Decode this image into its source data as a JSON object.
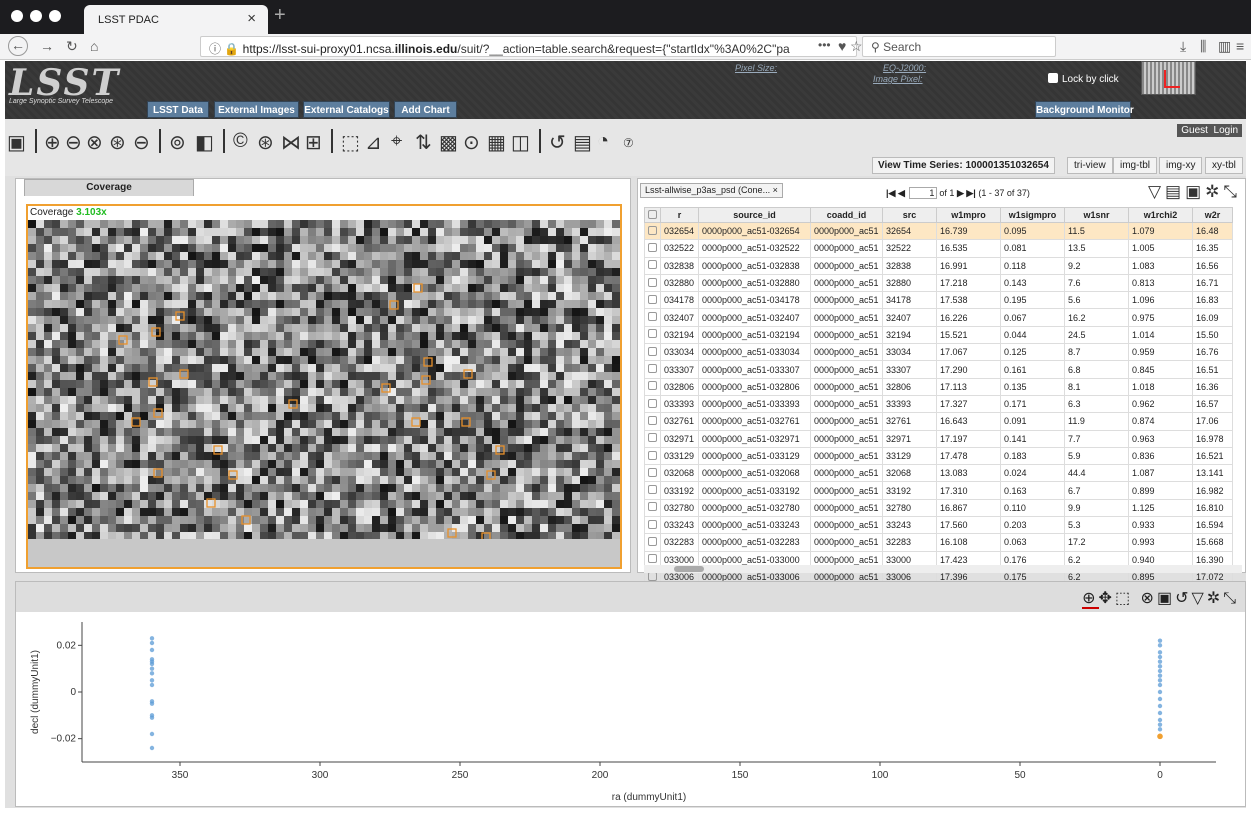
{
  "browser": {
    "tab_title": "LSST PDAC",
    "url_prefix": "https://lsst-sui-proxy01.ncsa.",
    "url_bold": "illinois.edu",
    "url_rest": "/suit/?__action=table.search&request={\"startIdx\"%3A0%2C\"pa",
    "search_placeholder": "Search"
  },
  "banner": {
    "logo_text": "LSST",
    "logo_subtitle": "Large Synoptic Survey Telescope",
    "buttons": [
      "LSST Data",
      "External Images",
      "External Catalogs",
      "Add Chart"
    ],
    "pixel_size_label": "Pixel Size:",
    "eq_label": "EQ-J2000:",
    "image_pixel_label": "Image Pixel:",
    "lock_label": "Lock by click",
    "background_monitor": "Background Monitor"
  },
  "toolbar": {
    "guest": "Guest",
    "login": "Login",
    "view_time_series": "View Time Series: 100001351032654",
    "layout_buttons": [
      "tri-view",
      "img-tbl",
      "img-xy",
      "xy-tbl"
    ]
  },
  "coverage": {
    "tab_label": "Coverage",
    "label": "Coverage",
    "zoom": "3.103x"
  },
  "table": {
    "tab_label": "Lsst-allwise_p3as_psd (Cone...",
    "page_value": "1",
    "page_of": "of 1",
    "range": "(1 - 37 of 37)",
    "columns": [
      "r",
      "source_id",
      "coadd_id",
      "src",
      "w1mpro",
      "w1sigmpro",
      "w1snr",
      "w1rchi2",
      "w2r"
    ],
    "rows": [
      [
        "032654",
        "0000p000_ac51-032654",
        "0000p000_ac51",
        "32654",
        "16.739",
        "0.095",
        "11.5",
        "1.079",
        "16.48"
      ],
      [
        "032522",
        "0000p000_ac51-032522",
        "0000p000_ac51",
        "32522",
        "16.535",
        "0.081",
        "13.5",
        "1.005",
        "16.35"
      ],
      [
        "032838",
        "0000p000_ac51-032838",
        "0000p000_ac51",
        "32838",
        "16.991",
        "0.118",
        "9.2",
        "1.083",
        "16.56"
      ],
      [
        "032880",
        "0000p000_ac51-032880",
        "0000p000_ac51",
        "32880",
        "17.218",
        "0.143",
        "7.6",
        "0.813",
        "16.71"
      ],
      [
        "034178",
        "0000p000_ac51-034178",
        "0000p000_ac51",
        "34178",
        "17.538",
        "0.195",
        "5.6",
        "1.096",
        "16.83"
      ],
      [
        "032407",
        "0000p000_ac51-032407",
        "0000p000_ac51",
        "32407",
        "16.226",
        "0.067",
        "16.2",
        "0.975",
        "16.09"
      ],
      [
        "032194",
        "0000p000_ac51-032194",
        "0000p000_ac51",
        "32194",
        "15.521",
        "0.044",
        "24.5",
        "1.014",
        "15.50"
      ],
      [
        "033034",
        "0000p000_ac51-033034",
        "0000p000_ac51",
        "33034",
        "17.067",
        "0.125",
        "8.7",
        "0.959",
        "16.76"
      ],
      [
        "033307",
        "0000p000_ac51-033307",
        "0000p000_ac51",
        "33307",
        "17.290",
        "0.161",
        "6.8",
        "0.845",
        "16.51"
      ],
      [
        "032806",
        "0000p000_ac51-032806",
        "0000p000_ac51",
        "32806",
        "17.113",
        "0.135",
        "8.1",
        "1.018",
        "16.36"
      ],
      [
        "033393",
        "0000p000_ac51-033393",
        "0000p000_ac51",
        "33393",
        "17.327",
        "0.171",
        "6.3",
        "0.962",
        "16.57"
      ],
      [
        "032761",
        "0000p000_ac51-032761",
        "0000p000_ac51",
        "32761",
        "16.643",
        "0.091",
        "11.9",
        "0.874",
        "17.06"
      ],
      [
        "032971",
        "0000p000_ac51-032971",
        "0000p000_ac51",
        "32971",
        "17.197",
        "0.141",
        "7.7",
        "0.963",
        "16.978"
      ],
      [
        "033129",
        "0000p000_ac51-033129",
        "0000p000_ac51",
        "33129",
        "17.478",
        "0.183",
        "5.9",
        "0.836",
        "16.521"
      ],
      [
        "032068",
        "0000p000_ac51-032068",
        "0000p000_ac51",
        "32068",
        "13.083",
        "0.024",
        "44.4",
        "1.087",
        "13.141"
      ],
      [
        "033192",
        "0000p000_ac51-033192",
        "0000p000_ac51",
        "33192",
        "17.310",
        "0.163",
        "6.7",
        "0.899",
        "16.982"
      ],
      [
        "032780",
        "0000p000_ac51-032780",
        "0000p000_ac51",
        "32780",
        "16.867",
        "0.110",
        "9.9",
        "1.125",
        "16.810"
      ],
      [
        "033243",
        "0000p000_ac51-033243",
        "0000p000_ac51",
        "33243",
        "17.560",
        "0.203",
        "5.3",
        "0.933",
        "16.594"
      ],
      [
        "032283",
        "0000p000_ac51-032283",
        "0000p000_ac51",
        "32283",
        "16.108",
        "0.063",
        "17.2",
        "0.993",
        "15.668"
      ],
      [
        "033000",
        "0000p000_ac51-033000",
        "0000p000_ac51",
        "33000",
        "17.423",
        "0.176",
        "6.2",
        "0.940",
        "16.390"
      ],
      [
        "033006",
        "0000p000_ac51-033006",
        "0000p000_ac51",
        "33006",
        "17.396",
        "0.175",
        "6.2",
        "0.895",
        "17.072"
      ]
    ]
  },
  "chart_data": {
    "type": "scatter",
    "xlabel": "ra (dummyUnit1)",
    "ylabel": "decl (dummyUnit1)",
    "xlim": [
      385,
      -20
    ],
    "ylim": [
      -0.03,
      0.03
    ],
    "xticks": [
      350,
      300,
      250,
      200,
      150,
      100,
      50,
      0
    ],
    "yticks": [
      0.02,
      0,
      -0.02
    ],
    "ytick_labels": [
      "0.02",
      "0",
      "−0.02"
    ],
    "point_color": "#5b9bd5",
    "highlight_color": "#f0a030",
    "points": [
      {
        "x": 360,
        "y": 0.023
      },
      {
        "x": 360,
        "y": 0.021
      },
      {
        "x": 360,
        "y": 0.018
      },
      {
        "x": 360,
        "y": 0.014
      },
      {
        "x": 360,
        "y": 0.013
      },
      {
        "x": 360,
        "y": 0.012
      },
      {
        "x": 360,
        "y": 0.01
      },
      {
        "x": 360,
        "y": 0.008
      },
      {
        "x": 360,
        "y": 0.005
      },
      {
        "x": 360,
        "y": 0.003
      },
      {
        "x": 360,
        "y": -0.004
      },
      {
        "x": 360,
        "y": -0.005
      },
      {
        "x": 360,
        "y": -0.01
      },
      {
        "x": 360,
        "y": -0.011
      },
      {
        "x": 360,
        "y": -0.018
      },
      {
        "x": 360,
        "y": -0.024
      },
      {
        "x": 0,
        "y": 0.022
      },
      {
        "x": 0,
        "y": 0.02
      },
      {
        "x": 0,
        "y": 0.017
      },
      {
        "x": 0,
        "y": 0.015
      },
      {
        "x": 0,
        "y": 0.013
      },
      {
        "x": 0,
        "y": 0.011
      },
      {
        "x": 0,
        "y": 0.009
      },
      {
        "x": 0,
        "y": 0.007
      },
      {
        "x": 0,
        "y": 0.005
      },
      {
        "x": 0,
        "y": 0.003
      },
      {
        "x": 0,
        "y": 0.0
      },
      {
        "x": 0,
        "y": -0.003
      },
      {
        "x": 0,
        "y": -0.006
      },
      {
        "x": 0,
        "y": -0.009
      },
      {
        "x": 0,
        "y": -0.012
      },
      {
        "x": 0,
        "y": -0.014
      },
      {
        "x": 0,
        "y": -0.016
      }
    ],
    "highlight": {
      "x": 0,
      "y": -0.019
    }
  }
}
